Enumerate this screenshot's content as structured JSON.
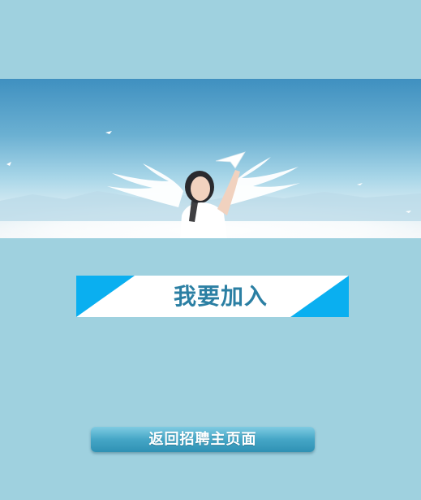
{
  "page": {
    "background_color": "#9fd1df"
  },
  "banner": {
    "image_description_icon": "angel-girl-paper-plane-image"
  },
  "join_title": {
    "text": "我要加入",
    "text_color": "#2b7fa3",
    "accent_color": "#0aaff0"
  },
  "return_button": {
    "label": "返回招聘主页面"
  }
}
